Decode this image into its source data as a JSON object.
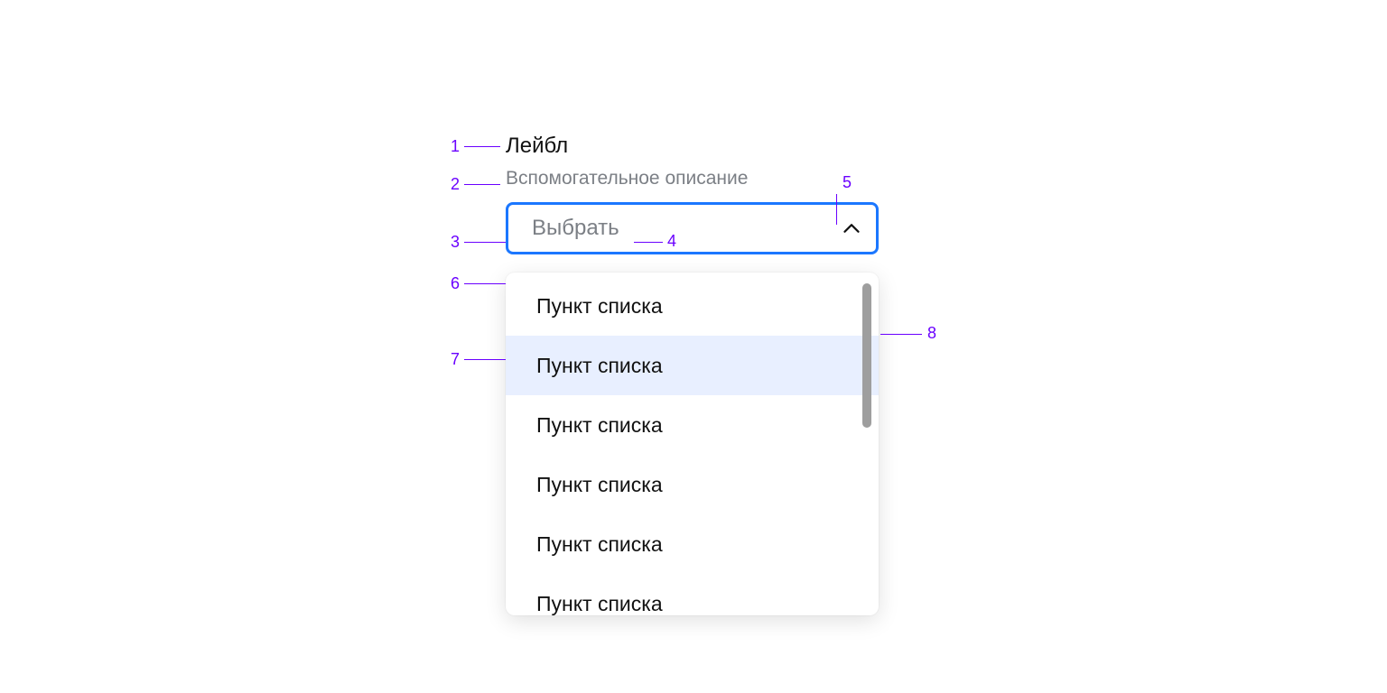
{
  "component": {
    "label": "Лейбл",
    "hint": "Вспомогательное описание",
    "placeholder": "Выбрать",
    "items": [
      {
        "label": "Пункт списка",
        "hovered": false
      },
      {
        "label": "Пункт списка",
        "hovered": true
      },
      {
        "label": "Пункт списка",
        "hovered": false
      },
      {
        "label": "Пункт списка",
        "hovered": false
      },
      {
        "label": "Пункт списка",
        "hovered": false
      },
      {
        "label": "Пункт списка",
        "hovered": false
      }
    ]
  },
  "annotations": {
    "a1": "1",
    "a2": "2",
    "a3": "3",
    "a4": "4",
    "a5": "5",
    "a6": "6",
    "a7": "7",
    "a8": "8"
  },
  "colors": {
    "annotation": "#6a00ff",
    "focus_border": "#1b77ff",
    "hint_text": "#7b7f85",
    "list_hover_bg": "#e8efff",
    "scrollbar": "#9e9e9e"
  }
}
